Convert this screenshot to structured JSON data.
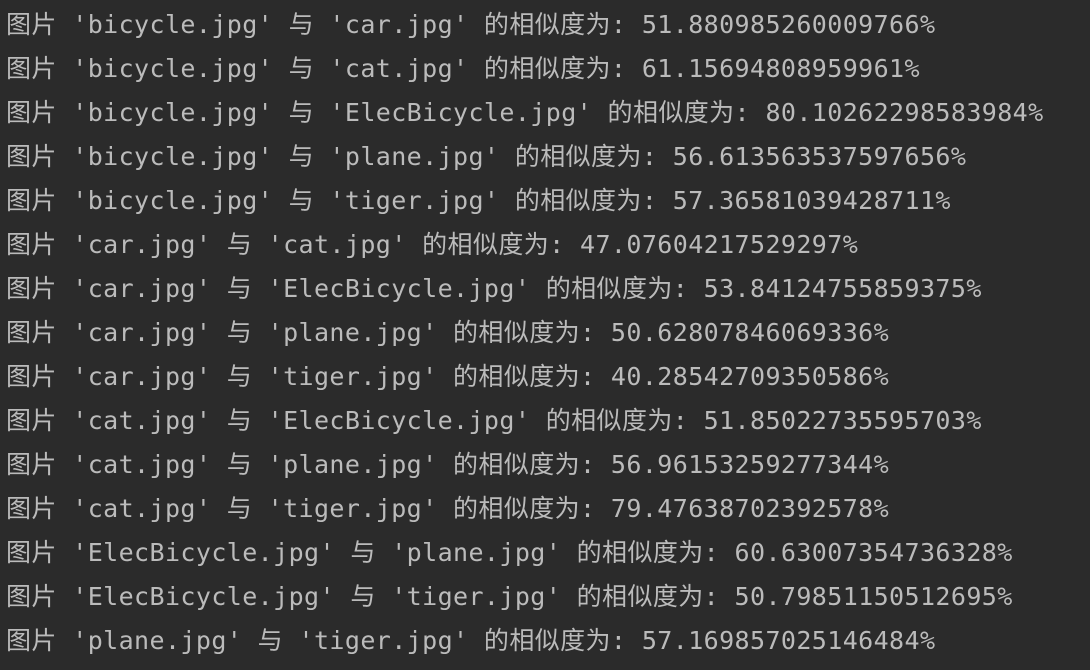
{
  "output": {
    "lines": [
      "图片 'bicycle.jpg' 与 'car.jpg' 的相似度为: 51.880985260009766%",
      "图片 'bicycle.jpg' 与 'cat.jpg' 的相似度为: 61.15694808959961%",
      "图片 'bicycle.jpg' 与 'ElecBicycle.jpg' 的相似度为: 80.10262298583984%",
      "图片 'bicycle.jpg' 与 'plane.jpg' 的相似度为: 56.613563537597656%",
      "图片 'bicycle.jpg' 与 'tiger.jpg' 的相似度为: 57.36581039428711%",
      "图片 'car.jpg' 与 'cat.jpg' 的相似度为: 47.07604217529297%",
      "图片 'car.jpg' 与 'ElecBicycle.jpg' 的相似度为: 53.84124755859375%",
      "图片 'car.jpg' 与 'plane.jpg' 的相似度为: 50.62807846069336%",
      "图片 'car.jpg' 与 'tiger.jpg' 的相似度为: 40.28542709350586%",
      "图片 'cat.jpg' 与 'ElecBicycle.jpg' 的相似度为: 51.85022735595703%",
      "图片 'cat.jpg' 与 'plane.jpg' 的相似度为: 56.96153259277344%",
      "图片 'cat.jpg' 与 'tiger.jpg' 的相似度为: 79.47638702392578%",
      "图片 'ElecBicycle.jpg' 与 'plane.jpg' 的相似度为: 60.63007354736328%",
      "图片 'ElecBicycle.jpg' 与 'tiger.jpg' 的相似度为: 50.79851150512695%",
      "图片 'plane.jpg' 与 'tiger.jpg' 的相似度为: 57.169857025146484%"
    ]
  },
  "colors": {
    "background": "#2b2b2b",
    "text": "#bbbbbb"
  }
}
